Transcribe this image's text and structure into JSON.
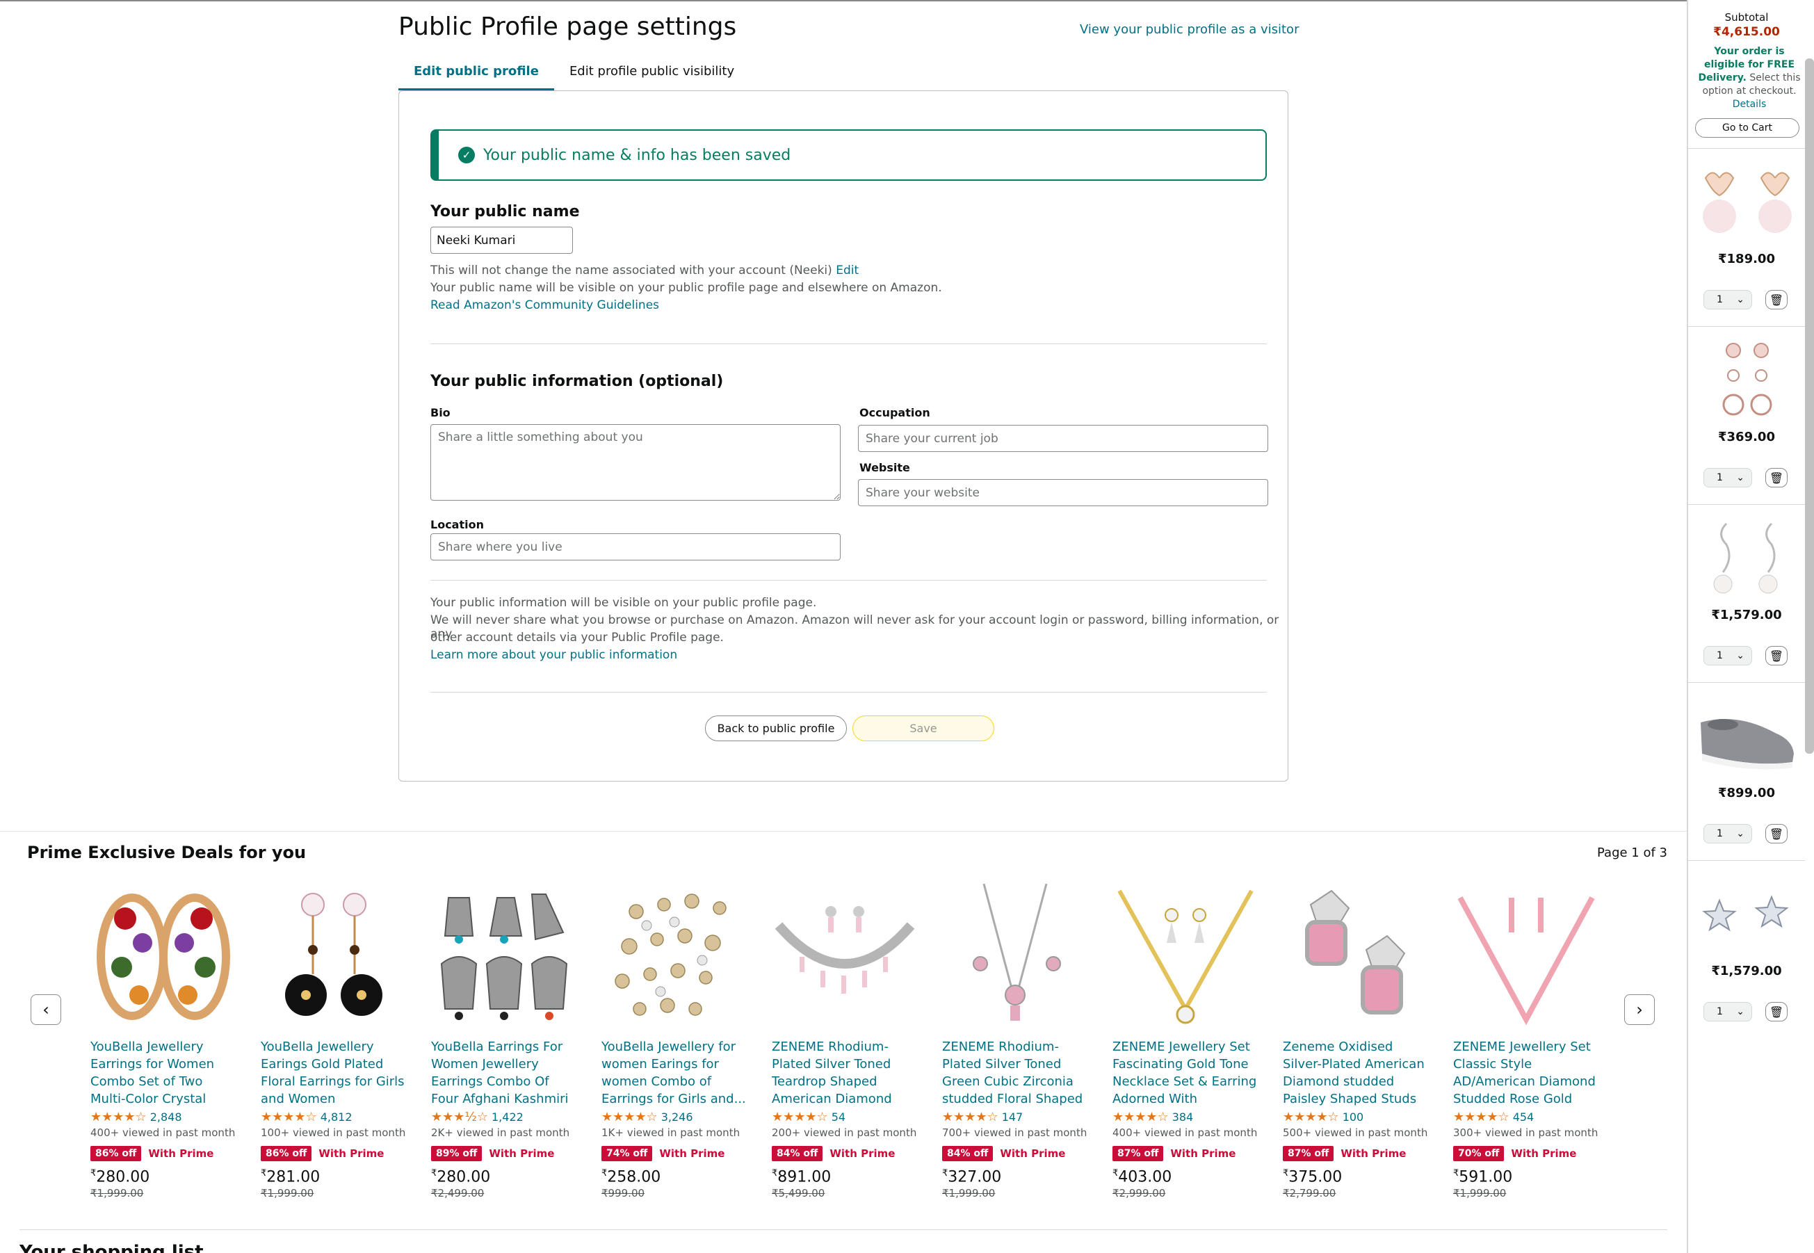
{
  "header": {
    "title": "Public Profile page settings",
    "visitor_link": "View your public profile as a visitor"
  },
  "tabs": [
    {
      "label": "Edit public profile",
      "active": true
    },
    {
      "label": "Edit profile public visibility",
      "active": false
    }
  ],
  "alert": {
    "text": "Your public name & info has been saved"
  },
  "public_name": {
    "heading": "Your public name",
    "value": "Neeki Kumari",
    "help_line1": "This will not change the name associated with your account (Neeki)",
    "edit_link": "Edit",
    "help_line2": "Your public name will be visible on your public profile page and elsewhere on Amazon.",
    "guidelines_link": "Read Amazon's Community Guidelines"
  },
  "public_info": {
    "heading": "Your public information (optional)",
    "bio_label": "Bio",
    "bio_placeholder": "Share a little something about you",
    "occupation_label": "Occupation",
    "occupation_placeholder": "Share your current job",
    "website_label": "Website",
    "website_placeholder": "Share your website",
    "location_label": "Location",
    "location_placeholder": "Share where you live",
    "note_line1": "Your public information will be visible on your public profile page.",
    "note_line2": "We will never share what you browse or purchase on Amazon. Amazon will never ask for your account login or password, billing information, or any",
    "note_line3": "other account details via your Public Profile page.",
    "learn_more_link": "Learn more about your public information"
  },
  "buttons": {
    "back": "Back to public profile",
    "save": "Save"
  },
  "deals": {
    "title": "Prime Exclusive Deals for you",
    "page_indicator": "Page 1 of 3",
    "products": [
      {
        "title": "YouBella Jewellery Earrings for Women Combo Set of Two Multi-Color Crystal earings ea...",
        "stars": "★★★★☆",
        "reviews": "2,848",
        "viewed": "400+ viewed in past month",
        "discount": "86% off",
        "prime": "With Prime",
        "price": "280.00",
        "mrp": "₹1,999.00"
      },
      {
        "title": "YouBella Jewellery Earings Gold Plated Floral Earrings for Girls and Women",
        "stars": "★★★★☆",
        "reviews": "4,812",
        "viewed": "100+ viewed in past month",
        "discount": "86% off",
        "prime": "With Prime",
        "price": "281.00",
        "mrp": "₹1,999.00"
      },
      {
        "title": "YouBella Earrings For Women Jewellery Earrings Combo Of Four Afghani Kashmiri Jhum...",
        "stars": "★★★½☆",
        "reviews": "1,422",
        "viewed": "2K+ viewed in past month",
        "discount": "89% off",
        "prime": "With Prime",
        "price": "280.00",
        "mrp": "₹2,499.00"
      },
      {
        "title": "YouBella Jewellery for women Earings for women Combo of Earrings for Girls and...",
        "stars": "★★★★☆",
        "reviews": "3,246",
        "viewed": "1K+ viewed in past month",
        "discount": "74% off",
        "prime": "With Prime",
        "price": "258.00",
        "mrp": "₹999.00"
      },
      {
        "title": "ZENEME Rhodium-Plated Silver Toned Teardrop Shaped American Diamond Studded...",
        "stars": "★★★★☆",
        "reviews": "54",
        "viewed": "200+ viewed in past month",
        "discount": "84% off",
        "prime": "With Prime",
        "price": "891.00",
        "mrp": "₹5,499.00"
      },
      {
        "title": "ZENEME Rhodium-Plated Silver Toned Green Cubic Zirconia studded Floral Shaped Cute Pendant...",
        "stars": "★★★★☆",
        "reviews": "147",
        "viewed": "700+ viewed in past month",
        "discount": "84% off",
        "prime": "With Prime",
        "price": "327.00",
        "mrp": "₹1,999.00"
      },
      {
        "title": "ZENEME Jewellery Set Fascinating Gold Tone Necklace Set & Earring Adorned With America...",
        "stars": "★★★★☆",
        "reviews": "384",
        "viewed": "400+ viewed in past month",
        "discount": "87% off",
        "prime": "With Prime",
        "price": "403.00",
        "mrp": "₹2,999.00"
      },
      {
        "title": "Zeneme Oxidised Silver-Plated American Diamond studded Paisley Shaped Studs Earrings ...",
        "stars": "★★★★☆",
        "reviews": "100",
        "viewed": "500+ viewed in past month",
        "discount": "87% off",
        "prime": "With Prime",
        "price": "375.00",
        "mrp": "₹2,799.00"
      },
      {
        "title": "ZENEME Jewellery Set Classic Style AD/American Diamond Studded Rose Gold Plated Handcrafte...",
        "stars": "★★★★☆",
        "reviews": "454",
        "viewed": "300+ viewed in past month",
        "discount": "70% off",
        "prime": "With Prime",
        "price": "591.00",
        "mrp": "₹1,999.00"
      }
    ]
  },
  "wishlist_peek": "Your shopping list",
  "cart": {
    "subtotal_label": "Subtotal",
    "subtotal_value": "₹4,615.00",
    "free_bold": "Your order is eligible for FREE Delivery.",
    "free_rest": "Select this option at checkout.",
    "details_link": "Details",
    "goto_cart": "Go to Cart",
    "items": [
      {
        "price": "₹189.00",
        "qty": "1"
      },
      {
        "price": "₹369.00",
        "qty": "1"
      },
      {
        "price": "₹1,579.00",
        "qty": "1"
      },
      {
        "price": "₹899.00",
        "qty": "1"
      },
      {
        "price": "₹1,579.00",
        "qty": "1"
      }
    ]
  },
  "colors": {
    "link": "#007185",
    "success": "#067d62",
    "deal_red": "#cc0c39",
    "price_red": "#b12704",
    "star": "#de7921"
  },
  "icons": [
    "check-circle-icon",
    "chevron-left-icon",
    "chevron-right-icon",
    "chevron-down-icon",
    "trash-icon"
  ]
}
